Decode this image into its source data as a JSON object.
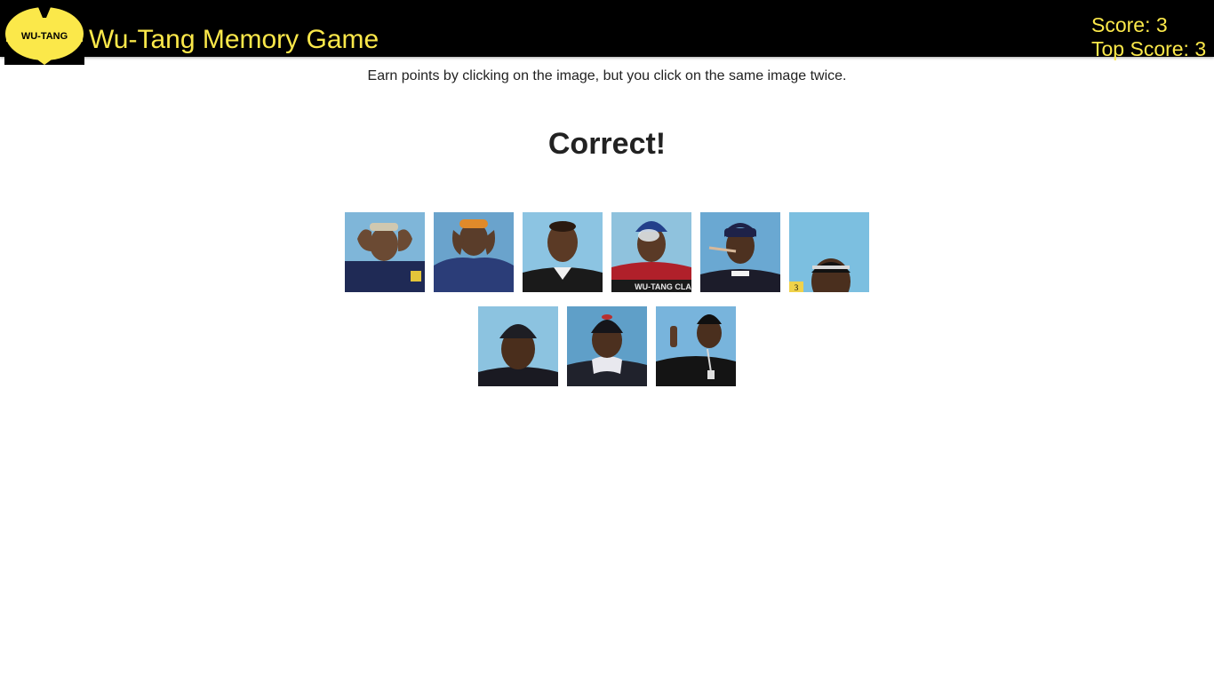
{
  "header": {
    "logo_text": "WU-TANG",
    "title": "Wu-Tang Memory Game",
    "score_label": "Score: 3",
    "top_score_label": "Top Score: 3"
  },
  "main": {
    "instructions": "Earn points by clicking on the image, but you click on the same image twice.",
    "result_message": "Correct!"
  },
  "cards": [
    {
      "name": "card-1",
      "caption": ""
    },
    {
      "name": "card-2",
      "caption": ""
    },
    {
      "name": "card-3",
      "caption": ""
    },
    {
      "name": "card-4",
      "caption": "WU-TANG CLA"
    },
    {
      "name": "card-5",
      "caption": ""
    },
    {
      "name": "card-6",
      "caption": "3"
    },
    {
      "name": "card-7",
      "caption": ""
    },
    {
      "name": "card-8",
      "caption": ""
    },
    {
      "name": "card-9",
      "caption": ""
    }
  ],
  "colors": {
    "accent_yellow": "#fbe84a",
    "navbar_bg": "#000000",
    "card_bg": "#6aa6cf"
  }
}
